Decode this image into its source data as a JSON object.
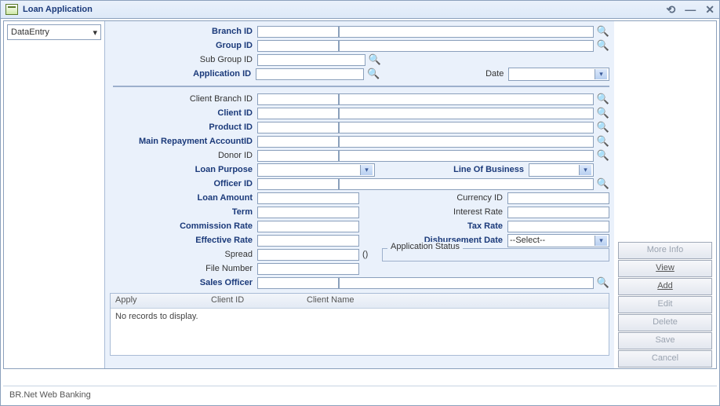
{
  "title": "Loan Application",
  "sidebar": {
    "mode": "DataEntry"
  },
  "form": {
    "branch_id_lbl": "Branch ID",
    "group_id_lbl": "Group ID",
    "sub_group_id_lbl": "Sub Group ID",
    "application_id_lbl": "Application ID",
    "date_lbl": "Date",
    "client_branch_id_lbl": "Client Branch ID",
    "client_id_lbl": "Client ID",
    "product_id_lbl": "Product ID",
    "main_repay_lbl": "Main Repayment AccountID",
    "donor_id_lbl": "Donor ID",
    "loan_purpose_lbl": "Loan Purpose",
    "line_of_business_lbl": "Line Of Business",
    "officer_id_lbl": "Officer ID",
    "loan_amount_lbl": "Loan Amount",
    "currency_id_lbl": "Currency ID",
    "term_lbl": "Term",
    "interest_rate_lbl": "Interest Rate",
    "commission_rate_lbl": "Commission Rate",
    "tax_rate_lbl": "Tax Rate",
    "effective_rate_lbl": "Effective Rate",
    "disbursement_date_lbl": "Disbursement Date",
    "disbursement_date_val": "--Select--",
    "spread_lbl": "Spread",
    "app_status_lbl": "Application Status",
    "file_number_lbl": "File Number",
    "sales_officer_lbl": "Sales Officer",
    "paren": "()"
  },
  "grid": {
    "cols": {
      "c1": "Apply",
      "c2": "Client ID",
      "c3": "Client Name"
    },
    "empty": "No records to display."
  },
  "buttons": {
    "more": "More Info",
    "view": "View",
    "add": "Add",
    "edit": "Edit",
    "delete": "Delete",
    "save": "Save",
    "cancel": "Cancel"
  },
  "status": "BR.Net Web Banking"
}
